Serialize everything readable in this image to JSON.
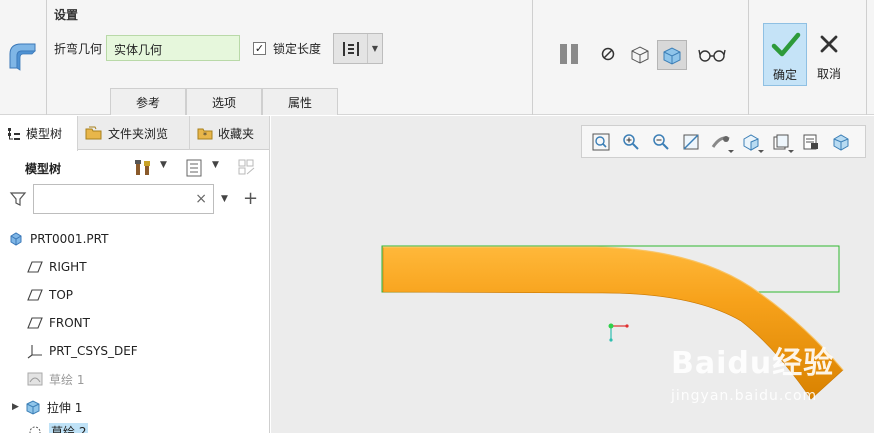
{
  "dashboard": {
    "settings_title": "设置",
    "bend_geometry_label": "折弯几何",
    "bend_geometry_value": "实体几何",
    "lock_length_label": "锁定长度",
    "lock_length_checked": "✓",
    "tabs": [
      "参考",
      "选项",
      "属性"
    ],
    "ok_label": "确定",
    "cancel_label": "取消"
  },
  "navigator": {
    "tabs": [
      "模型树",
      "文件夹浏览",
      "收藏夹"
    ],
    "tree_title": "模型树",
    "filter_placeholder": "",
    "filter_clear": "×",
    "items": [
      {
        "label": "PRT0001.PRT",
        "icon": "part-icon"
      },
      {
        "label": "RIGHT",
        "icon": "datum-plane-icon"
      },
      {
        "label": "TOP",
        "icon": "datum-plane-icon"
      },
      {
        "label": "FRONT",
        "icon": "datum-plane-icon"
      },
      {
        "label": "PRT_CSYS_DEF",
        "icon": "csys-icon"
      },
      {
        "label": "草绘 1",
        "icon": "sketch-icon"
      },
      {
        "label": "拉伸 1",
        "icon": "extrude-icon"
      },
      {
        "label": "草绘 2",
        "icon": "sketch-icon"
      }
    ]
  },
  "graphics": {
    "watermark_brand": "Baidu经验",
    "watermark_sub": "jingyan.baidu.com"
  },
  "colors": {
    "accent": "#8fc0e3",
    "ok_check": "#2e9a3a",
    "model": "#f39c12",
    "field_bg": "#e6f7dc"
  }
}
